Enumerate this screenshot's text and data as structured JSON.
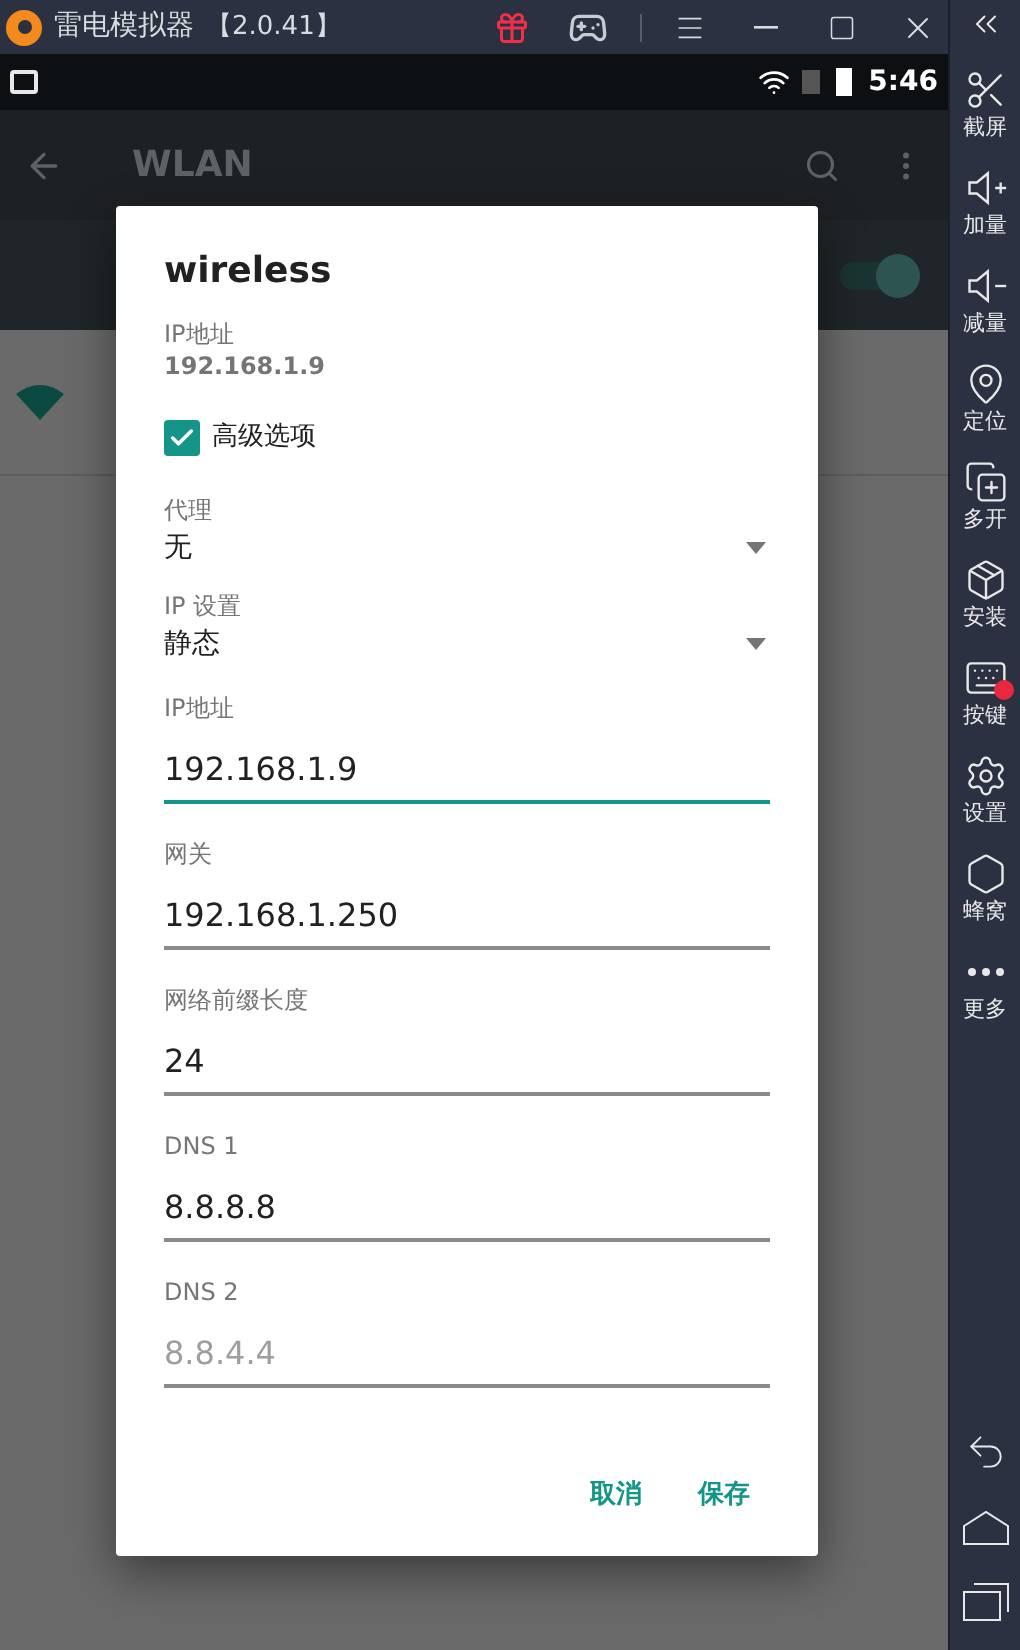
{
  "window": {
    "title": "雷电模拟器",
    "version": "【2.0.41】"
  },
  "status_bar": {
    "time": "5:46"
  },
  "app_bar": {
    "title": "WLAN"
  },
  "wlan_switch": {
    "on": true
  },
  "dialog": {
    "title": "wireless",
    "ip_label": "IP地址",
    "ip_value": "192.168.1.9",
    "advanced": {
      "label": "高级选项",
      "checked": true
    },
    "dropdowns": [
      {
        "label": "代理",
        "value": "无"
      },
      {
        "label": "IP 设置",
        "value": "静态"
      }
    ],
    "fields": [
      {
        "label": "IP地址",
        "value": "192.168.1.9",
        "focused": true
      },
      {
        "label": "网关",
        "value": "192.168.1.250",
        "focused": false
      },
      {
        "label": "网络前缀长度",
        "value": "24",
        "focused": false
      },
      {
        "label": "DNS 1",
        "value": "8.8.8.8",
        "focused": false
      },
      {
        "label": "DNS 2",
        "placeholder": "8.8.4.4",
        "focused": false
      }
    ],
    "buttons": [
      "取消",
      "保存"
    ]
  },
  "sidebar": {
    "items": [
      {
        "kind": "screenshot",
        "label": "截屏"
      },
      {
        "kind": "volume_up",
        "label": "加量"
      },
      {
        "kind": "volume_down",
        "label": "减量"
      },
      {
        "kind": "location",
        "label": "定位"
      },
      {
        "kind": "multi",
        "label": "多开"
      },
      {
        "kind": "apk",
        "label": "安装"
      },
      {
        "kind": "keys",
        "label": "按键"
      },
      {
        "kind": "settings",
        "label": "设置"
      },
      {
        "kind": "hive",
        "label": "蜂窝"
      },
      {
        "kind": "more",
        "label": "更多"
      }
    ]
  }
}
